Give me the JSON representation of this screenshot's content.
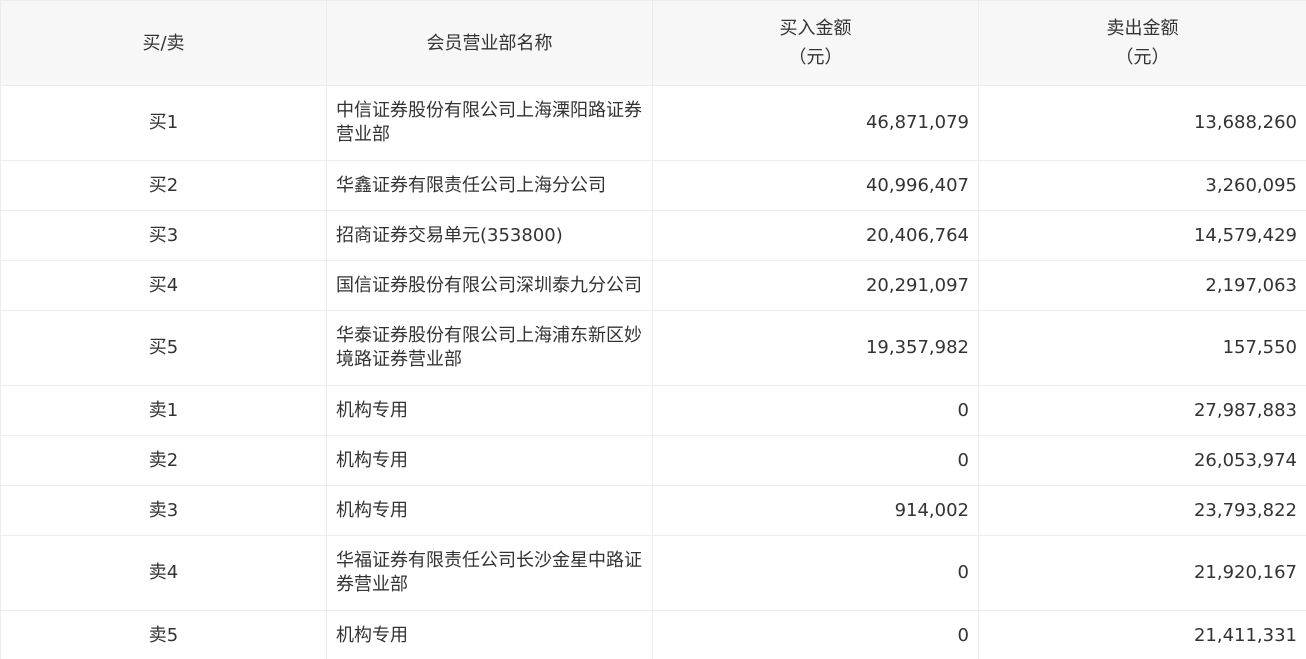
{
  "header": {
    "side": "买/卖",
    "branch": "会员营业部名称",
    "buy_amount": "买入金额",
    "buy_unit": "（元）",
    "sell_amount": "卖出金额",
    "sell_unit": "（元）"
  },
  "rows": [
    {
      "side": "买1",
      "branch_line1": "中信证券股份有限公司上海溧阳路证券",
      "branch_line2": "营业部",
      "buy": "46,871,079",
      "sell": "13,688,260"
    },
    {
      "side": "买2",
      "branch_line1": "华鑫证券有限责任公司上海分公司",
      "branch_line2": "",
      "buy": "40,996,407",
      "sell": "3,260,095"
    },
    {
      "side": "买3",
      "branch_line1": "招商证券交易单元(353800)",
      "branch_line2": "",
      "buy": "20,406,764",
      "sell": "14,579,429"
    },
    {
      "side": "买4",
      "branch_line1": "国信证券股份有限公司深圳泰九分公司",
      "branch_line2": "",
      "buy": "20,291,097",
      "sell": "2,197,063"
    },
    {
      "side": "买5",
      "branch_line1": "华泰证券股份有限公司上海浦东新区妙",
      "branch_line2": "境路证券营业部",
      "buy": "19,357,982",
      "sell": "157,550"
    },
    {
      "side": "卖1",
      "branch_line1": "机构专用",
      "branch_line2": "",
      "buy": "0",
      "sell": "27,987,883"
    },
    {
      "side": "卖2",
      "branch_line1": "机构专用",
      "branch_line2": "",
      "buy": "0",
      "sell": "26,053,974"
    },
    {
      "side": "卖3",
      "branch_line1": "机构专用",
      "branch_line2": "",
      "buy": "914,002",
      "sell": "23,793,822"
    },
    {
      "side": "卖4",
      "branch_line1": "华福证券有限责任公司长沙金星中路证",
      "branch_line2": "券营业部",
      "buy": "0",
      "sell": "21,920,167"
    },
    {
      "side": "卖5",
      "branch_line1": "机构专用",
      "branch_line2": "",
      "buy": "0",
      "sell": "21,411,331"
    }
  ]
}
